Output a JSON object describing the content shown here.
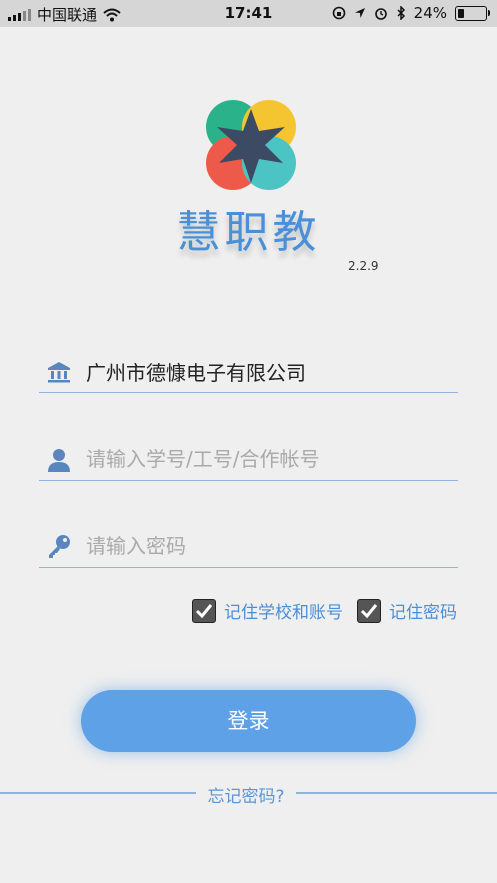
{
  "status_bar": {
    "carrier": "中国联通",
    "time": "17:41",
    "battery_percent": "24%",
    "battery_level": 0.24,
    "icons": [
      "signal-icon",
      "wifi-icon",
      "rotation-lock-icon",
      "location-icon",
      "alarm-icon",
      "bluetooth-icon",
      "battery-icon"
    ]
  },
  "app": {
    "name": "慧职教",
    "version": "2.2.9"
  },
  "form": {
    "school_value": "广州市德慷电子有限公司",
    "account_placeholder": "请输入学号/工号/合作帐号",
    "password_placeholder": "请输入密码",
    "remember_school_label": "记住学校和账号",
    "remember_school_checked": true,
    "remember_password_label": "记住密码",
    "remember_password_checked": true,
    "login_label": "登录",
    "forgot_label": "忘记密码?"
  },
  "colors": {
    "accent": "#4a90d9",
    "button": "#5fa1e6",
    "background": "#efefef"
  }
}
